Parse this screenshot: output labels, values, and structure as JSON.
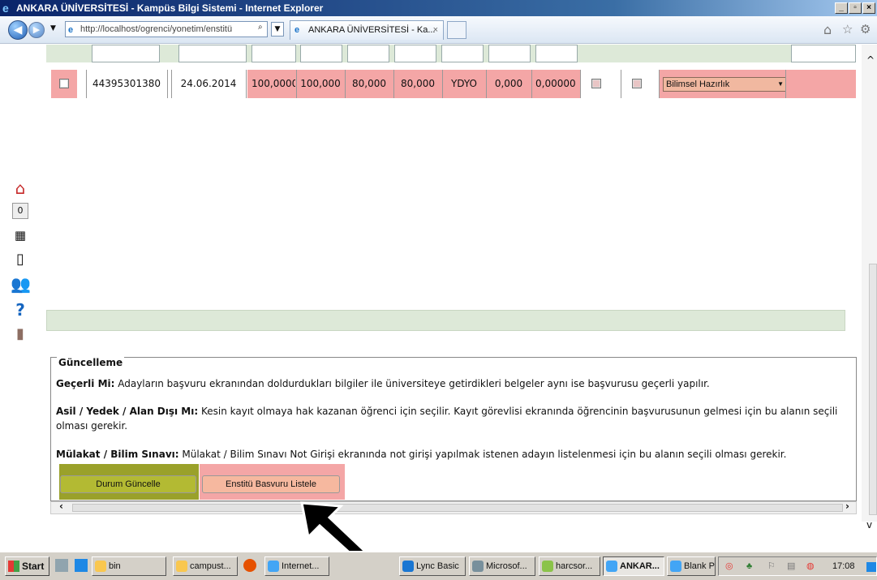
{
  "window": {
    "title": "ANKARA ÜNİVERSİTESİ - Kampüs Bilgi Sistemi - Internet Explorer"
  },
  "browser": {
    "address": "http://localhost/ogrenci/yonetim/enstitü",
    "tab_title": "ANKARA ÜNİVERSİTESİ - Ka...",
    "tab_close": "×"
  },
  "table_row": {
    "id": "44395301380",
    "date": "24.06.2014",
    "v1": "100,0000",
    "v2": "100,000",
    "v3": "80,000",
    "v4": "80,000",
    "dept": "YDYO",
    "v5": "0,000",
    "v6": "0,00000",
    "select_value": "Bilimsel Hazırlık"
  },
  "update": {
    "legend": "Güncelleme",
    "p1_label": "Geçerli Mi:",
    "p1_text": " Adayların başvuru ekranından doldurdukları bilgiler ile üniversiteye getirdikleri belgeler aynı ise başvurusu geçerli yapılır.",
    "p2_label": "Asil / Yedek / Alan Dışı Mı:",
    "p2_text": " Kesin kayıt olmaya hak kazanan öğrenci için seçilir. Kayıt görevlisi ekranında öğrencinin başvurusunun gelmesi için bu alanın seçili olması gerekir.",
    "p3_label": "Mülakat / Bilim Sınavı:",
    "p3_text": " Mülakat / Bilim Sınavı Not Girişi ekranında not girişi yapılmak istenen adayın listelenmesi için bu alanın seçili olması gerekir.",
    "btn_update": "Durum Güncelle",
    "btn_list": "Enstitü Basvuru Listele"
  },
  "taskbar": {
    "start": "Start",
    "items": [
      "bin",
      "campust...",
      "Internet...",
      "Lync Basic",
      "Microsof...",
      "harcsor...",
      "ANKAR...",
      "Blank Pa..."
    ],
    "clock": "17:08"
  }
}
